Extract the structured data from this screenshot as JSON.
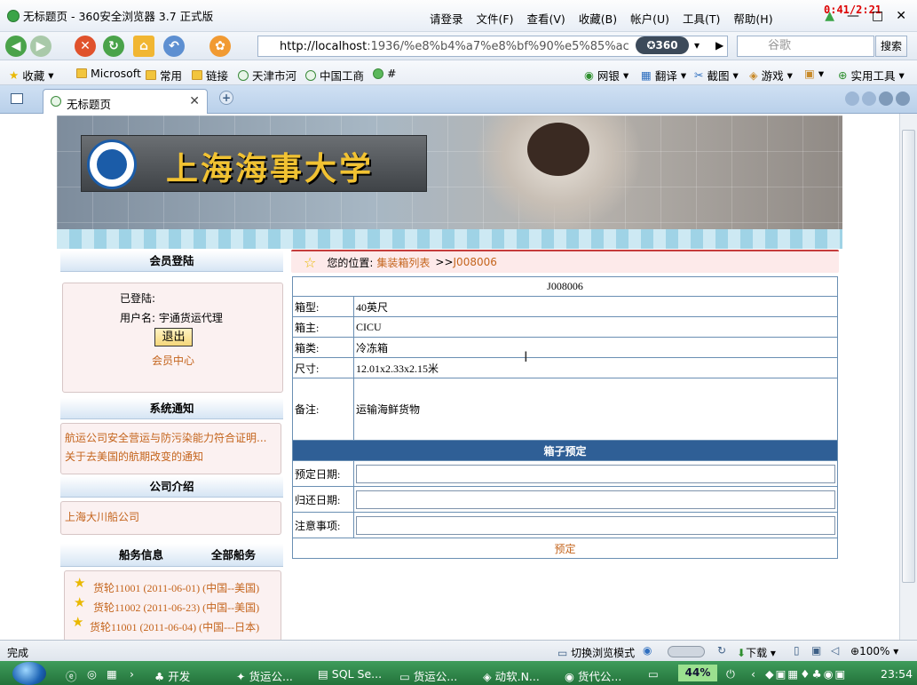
{
  "window": {
    "title": "无标题页 - 360安全浏览器 3.7 正式版",
    "clock": "0:41/2:21",
    "menu": [
      "请登录",
      "文件(F)",
      "查看(V)",
      "收藏(B)",
      "帐户(U)",
      "工具(T)",
      "帮助(H)"
    ]
  },
  "nav": {
    "url_host": "http://localhost",
    "url_rest": ":1936/%e8%b4%a7%e8%bf%90%e5%85%ac",
    "badge": "✪360",
    "search_placeholder": "谷歌",
    "search_button": "搜索"
  },
  "favorites": {
    "left": [
      "收藏",
      "Microsoft",
      "常用",
      "链接",
      "天津市河",
      "中国工商",
      "#"
    ],
    "right": [
      "网银",
      "翻译",
      "截图",
      "游戏",
      "实用工具"
    ]
  },
  "tab": {
    "label": "无标题页"
  },
  "sidebar": {
    "member": {
      "head": "会员登陆",
      "status": "已登陆:",
      "username_label": "用户名:",
      "username": "宇通货运代理",
      "logout": "退出",
      "center": "会员中心"
    },
    "notice": {
      "head": "系统通知",
      "items": [
        "航运公司安全营运与防污染能力符合证明...",
        "关于去美国的航期改变的通知"
      ]
    },
    "company": {
      "head": "公司介绍",
      "item": "上海大川船公司"
    },
    "ships": {
      "head_left": "船务信息",
      "head_right": "全部船务",
      "items": [
        "货轮11001 (2011-06-01) (中国--美国)",
        "货轮11002 (2011-06-23) (中国--美国)",
        "货轮11001 (2011-06-04) (中国---日本)"
      ]
    }
  },
  "breadcrumb": {
    "prefix": "您的位置:",
    "link": "集装箱列表",
    "sep": ">>",
    "current": "J008006"
  },
  "detail": {
    "title": "J008006",
    "rows": [
      {
        "label": "箱型:",
        "value": "40英尺"
      },
      {
        "label": "箱主:",
        "value": "CICU"
      },
      {
        "label": "箱类:",
        "value": "冷冻箱"
      },
      {
        "label": "尺寸:",
        "value": "12.01x2.33x2.15米"
      },
      {
        "label": "备注:",
        "value": "运输海鲜货物"
      }
    ]
  },
  "booking": {
    "head": "箱子预定",
    "fields": [
      "预定日期:",
      "归还日期:",
      "注意事项:"
    ],
    "submit": "预定"
  },
  "status": {
    "text": "完成",
    "mode": "切换浏览模式",
    "download": "下载",
    "zoom": "100%"
  },
  "taskbar": {
    "items": [
      "开发",
      "货运公...",
      "SQL Se...",
      "货运公...",
      "动软.N...",
      "货代公..."
    ],
    "battery": "44%",
    "time": "23:54"
  },
  "colors": {
    "accent": "#2f5f96",
    "link": "#c4641c",
    "breadcrumb_border": "#c53c3c"
  }
}
